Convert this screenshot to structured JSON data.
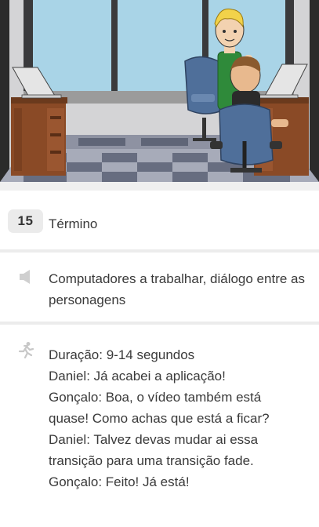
{
  "scene": {
    "number": "15",
    "title": "Término"
  },
  "sound": {
    "icon": "speaker-icon",
    "text": "Computadores a trabalhar, diálogo entre as personagens"
  },
  "action": {
    "icon": "running-person-icon",
    "lines": [
      "Duração: 9-14 segundos",
      "Daniel: Já acabei a aplicação!",
      "Gonçalo: Boa, o vídeo também está",
      "quase! Como achas que está a ficar?",
      "Daniel: Talvez devas mudar ai essa",
      "transição para uma transição fade.",
      "Gonçalo: Feito! Já está!"
    ]
  },
  "colors": {
    "wall": "#d8d8d8",
    "window_sky": "#a8d3e6",
    "desk": "#8a4a26",
    "chair": "#4f6f9a",
    "floor_dark": "#6e7486",
    "floor_light": "#b9bcc8"
  }
}
